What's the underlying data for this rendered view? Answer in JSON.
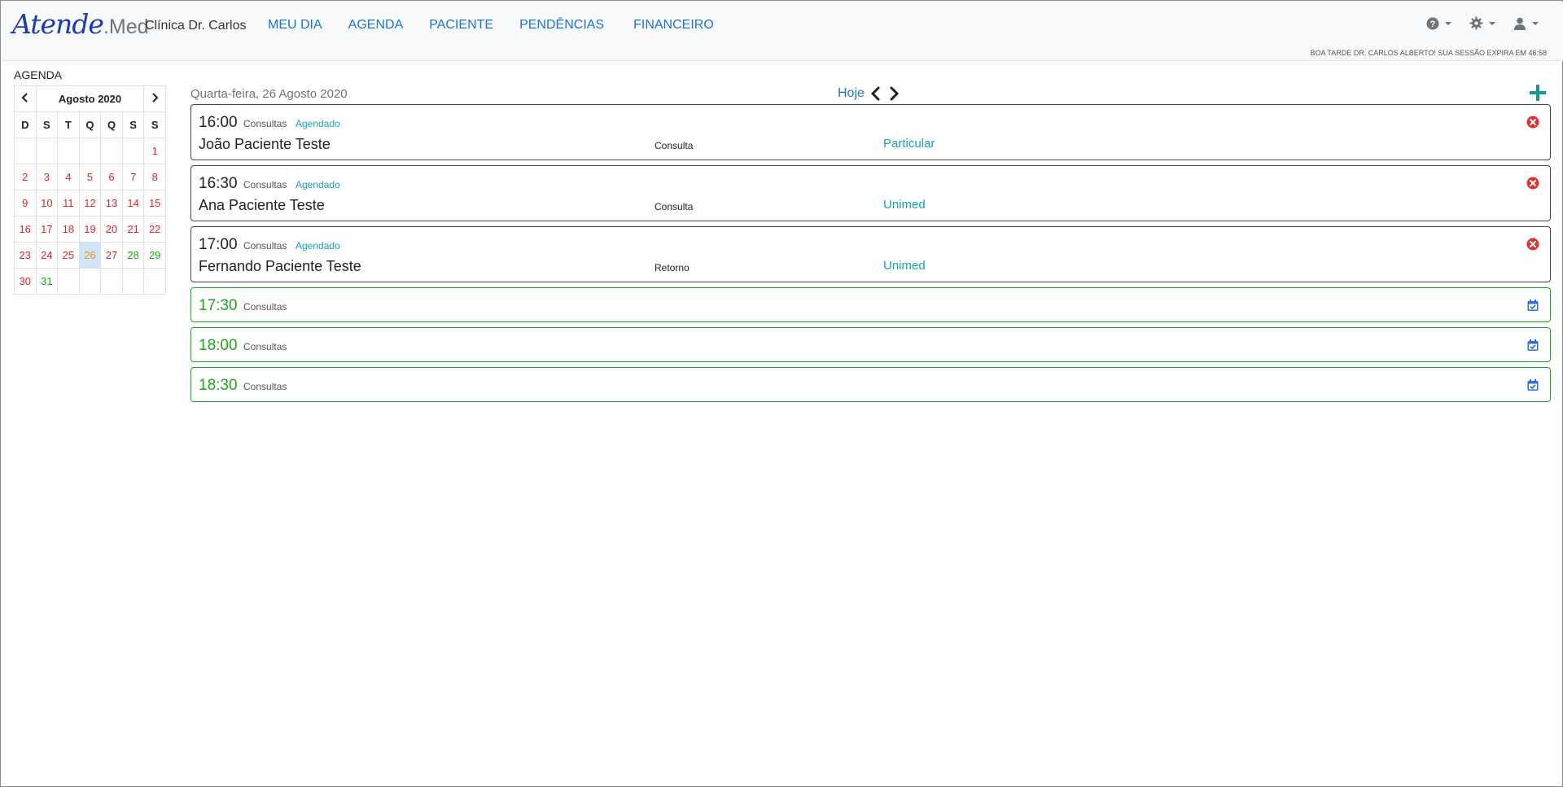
{
  "app": {
    "brand_script": "Atende",
    "brand_suffix": ".Med",
    "clinic": "Clínica Dr. Carlos"
  },
  "nav": {
    "items": [
      {
        "label": "MEU DIA"
      },
      {
        "label": "AGENDA"
      },
      {
        "label": "PACIENTE"
      },
      {
        "label": "PENDÊNCIAS"
      },
      {
        "label": "FINANCEIRO"
      }
    ],
    "right_icons": [
      "help-icon",
      "gear-icon",
      "user-icon"
    ],
    "session_text": "BOA TARDE  DR. CARLOS ALBERTO!  SUA SESSÃO EXPIRA EM  46:58"
  },
  "sidebar": {
    "title": "AGENDA",
    "calendar": {
      "month_label": "Agosto 2020",
      "prev": "‹",
      "next": "›",
      "weekdays": [
        "D",
        "S",
        "T",
        "Q",
        "Q",
        "S",
        "S"
      ],
      "weeks": [
        [
          "",
          "",
          "",
          "",
          "",
          "",
          "1"
        ],
        [
          "2",
          "3",
          "4",
          "5",
          "6",
          "7",
          "8"
        ],
        [
          "9",
          "10",
          "11",
          "12",
          "13",
          "14",
          "15"
        ],
        [
          "16",
          "17",
          "18",
          "19",
          "20",
          "21",
          "22"
        ],
        [
          "23",
          "24",
          "25",
          "26",
          "27",
          "28",
          "29"
        ],
        [
          "30",
          "31",
          "",
          "",
          "",
          "",
          ""
        ]
      ],
      "selected_day": "26",
      "green_days": [
        "28",
        "29",
        "31"
      ]
    }
  },
  "main": {
    "date_label": "Quarta-feira, 26 Agosto 2020",
    "today_label": "Hoje",
    "colors": {
      "booked_border": "#444444",
      "free_border": "#1ea51e",
      "status": "#17a2b8",
      "cancel": "#e03131",
      "calendar_check": "#2f6fd6",
      "add": "#139a8a"
    },
    "slots": [
      {
        "time": "16:00",
        "kind": "Consultas",
        "status": "Agendado",
        "patient": "João Paciente Teste",
        "procedure": "Consulta",
        "plan": "Particular"
      },
      {
        "time": "16:30",
        "kind": "Consultas",
        "status": "Agendado",
        "patient": "Ana Paciente Teste",
        "procedure": "Consulta",
        "plan": "Unimed"
      },
      {
        "time": "17:00",
        "kind": "Consultas",
        "status": "Agendado",
        "patient": "Fernando Paciente Teste",
        "procedure": "Retorno",
        "plan": "Unimed"
      },
      {
        "time": "17:30",
        "kind": "Consultas"
      },
      {
        "time": "18:00",
        "kind": "Consultas"
      },
      {
        "time": "18:30",
        "kind": "Consultas"
      }
    ]
  }
}
